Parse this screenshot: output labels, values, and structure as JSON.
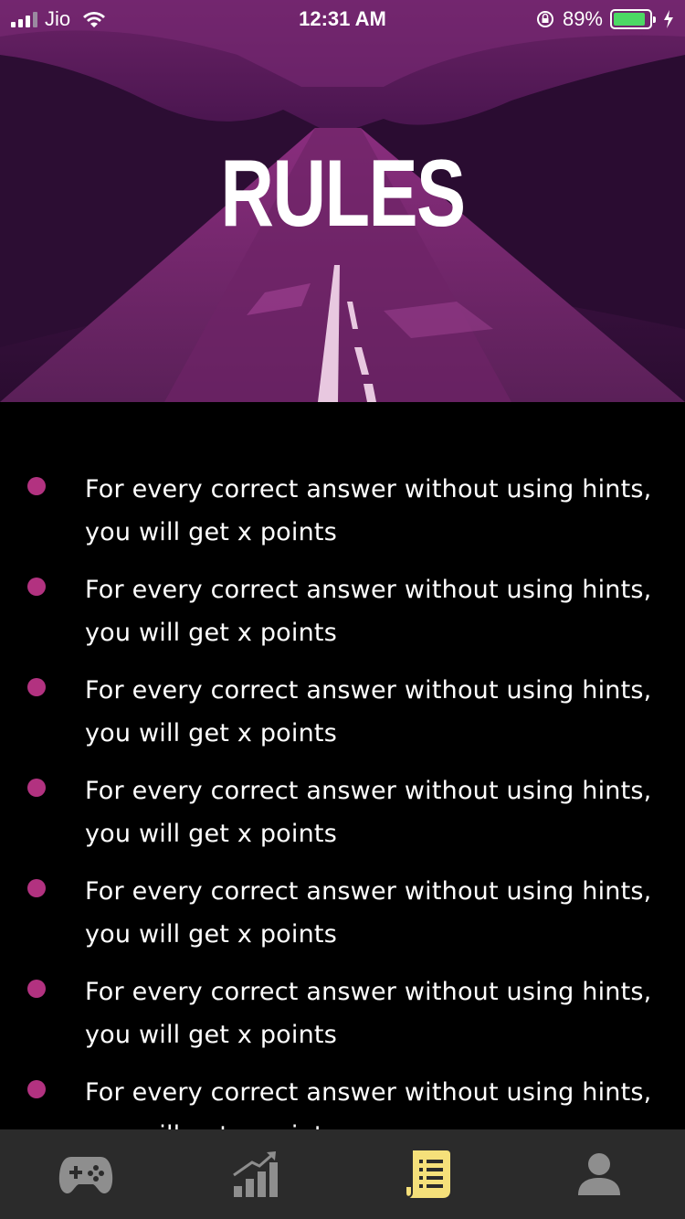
{
  "status_bar": {
    "carrier": "Jio",
    "time": "12:31 AM",
    "battery_percent": "89%",
    "battery_level": 0.89,
    "icons": [
      "signal-icon",
      "wifi-icon",
      "orientation-lock-icon",
      "battery-icon",
      "charging-icon"
    ]
  },
  "hero": {
    "title": "RULES",
    "background": "purple-tinted road through forest"
  },
  "rules": [
    {
      "text": "For every correct answer without using hints, you will get x points"
    },
    {
      "text": "For every correct answer without using hints, you will get x points"
    },
    {
      "text": "For every correct answer without using hints, you will get x points"
    },
    {
      "text": "For every correct answer without using hints, you will get x points"
    },
    {
      "text": "For every correct answer without using hints, you will get x points"
    },
    {
      "text": "For every correct answer without using hints, you will get x points"
    },
    {
      "text": "For every correct answer without using hints, you will get x points"
    }
  ],
  "tab_bar": {
    "tabs": [
      {
        "icon": "gamepad-icon",
        "active": false
      },
      {
        "icon": "stats-icon",
        "active": false
      },
      {
        "icon": "rules-scroll-icon",
        "active": true
      },
      {
        "icon": "profile-icon",
        "active": false
      }
    ]
  },
  "colors": {
    "accent_bullet": "#b23280",
    "tab_active": "#f5e07a",
    "tab_inactive": "#8e8e8e",
    "tab_bar_bg": "#2b2b2b"
  }
}
